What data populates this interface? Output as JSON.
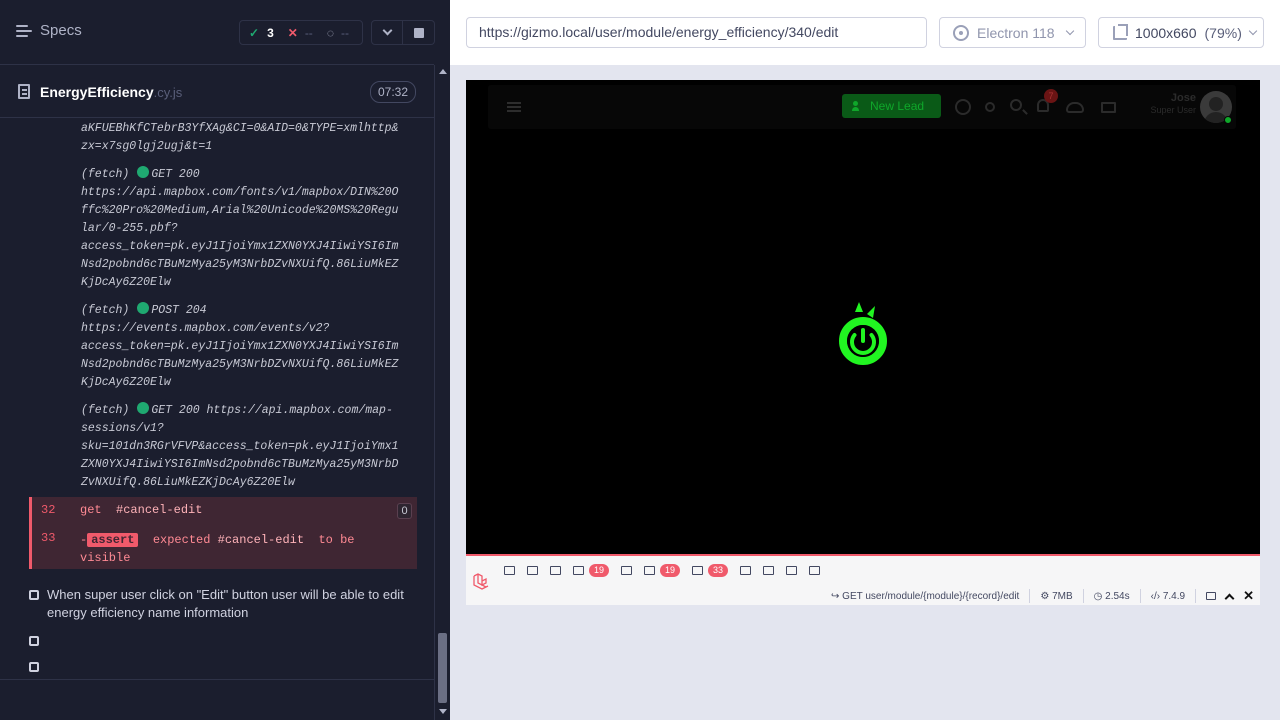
{
  "runner": {
    "specs_label": "Specs",
    "stats": {
      "passed": "3",
      "failed": "--",
      "pending": "--"
    },
    "file": {
      "name": "EnergyEfficiency",
      "ext": ".cy.js",
      "duration": "07:32"
    },
    "log_prefix_lines": [
      "aKFUEBhKfCTebrB3YfXAg&CI=0&AID=0&TYPE=xmlhttp&",
      "zx=x7sg0lgj2ugj&t=1"
    ],
    "logs": [
      {
        "label": "(fetch)",
        "status": "GET 200",
        "lines": [
          "https://api.mapbox.com/fonts/v1/mapbox/DIN%20O",
          "ffc%20Pro%20Medium,Arial%20Unicode%20MS%20Regu",
          "lar/0-255.pbf?",
          "access_token=pk.eyJ1IjoiYmx1ZXN0YXJ4IiwiYSI6Im",
          "Nsd2pobnd6cTBuMzMya25yM3NrbDZvNXUifQ.86LiuMkEZ",
          "KjDcAy6Z20Elw"
        ]
      },
      {
        "label": "(fetch)",
        "status": "POST 204",
        "lines": [
          "https://events.mapbox.com/events/v2?",
          "access_token=pk.eyJ1IjoiYmx1ZXN0YXJ4IiwiYSI6Im",
          "Nsd2pobnd6cTBuMzMya25yM3NrbDZvNXUifQ.86LiuMkEZ",
          "KjDcAy6Z20Elw"
        ]
      },
      {
        "label": "(fetch)",
        "status": "GET 200",
        "inline_url": "https://api.mapbox.com/map-",
        "lines": [
          "sessions/v1?",
          "sku=101dn3RGrVFVP&access_token=pk.eyJ1IjoiYmx1",
          "ZXN0YXJ4IiwiYSI6ImNsd2pobnd6cTBuMzMya25yM3NrbD",
          "ZvNXUifQ.86LiuMkEZKjDcAy6Z20Elw"
        ]
      }
    ],
    "commands": [
      {
        "number": "32",
        "name": "get",
        "selector": "#cancel-edit",
        "count": "0"
      },
      {
        "number": "33",
        "prefix": "-",
        "tag": "assert",
        "text1": "expected",
        "selector": "#cancel-edit",
        "text2": "to be",
        "text3": "visible"
      }
    ],
    "tests": [
      {
        "title_line1": "When super user click on \"Edit\" button user will be able to edit",
        "title_line2": "energy efficiency name information"
      },
      {
        "title_line1": "",
        "title_line2": ""
      },
      {
        "title_line1": "",
        "title_line2": ""
      }
    ]
  },
  "preview": {
    "url": "https://gizmo.local/user/module/energy_efficiency/340/edit",
    "browser": "Electron 118",
    "viewport": "1000x660",
    "zoom": "(79%)",
    "app": {
      "new_lead_label": "New Lead",
      "notification_count": "7",
      "user_name": "Jose",
      "user_role": "Super User",
      "loader_color": "#21f521"
    },
    "debugbar": {
      "tab_badges": [
        "19",
        "19",
        "33"
      ],
      "route": "GET user/module/{module}/{record}/edit",
      "memory": "7MB",
      "time": "2.54s",
      "version": "7.4.9"
    }
  }
}
